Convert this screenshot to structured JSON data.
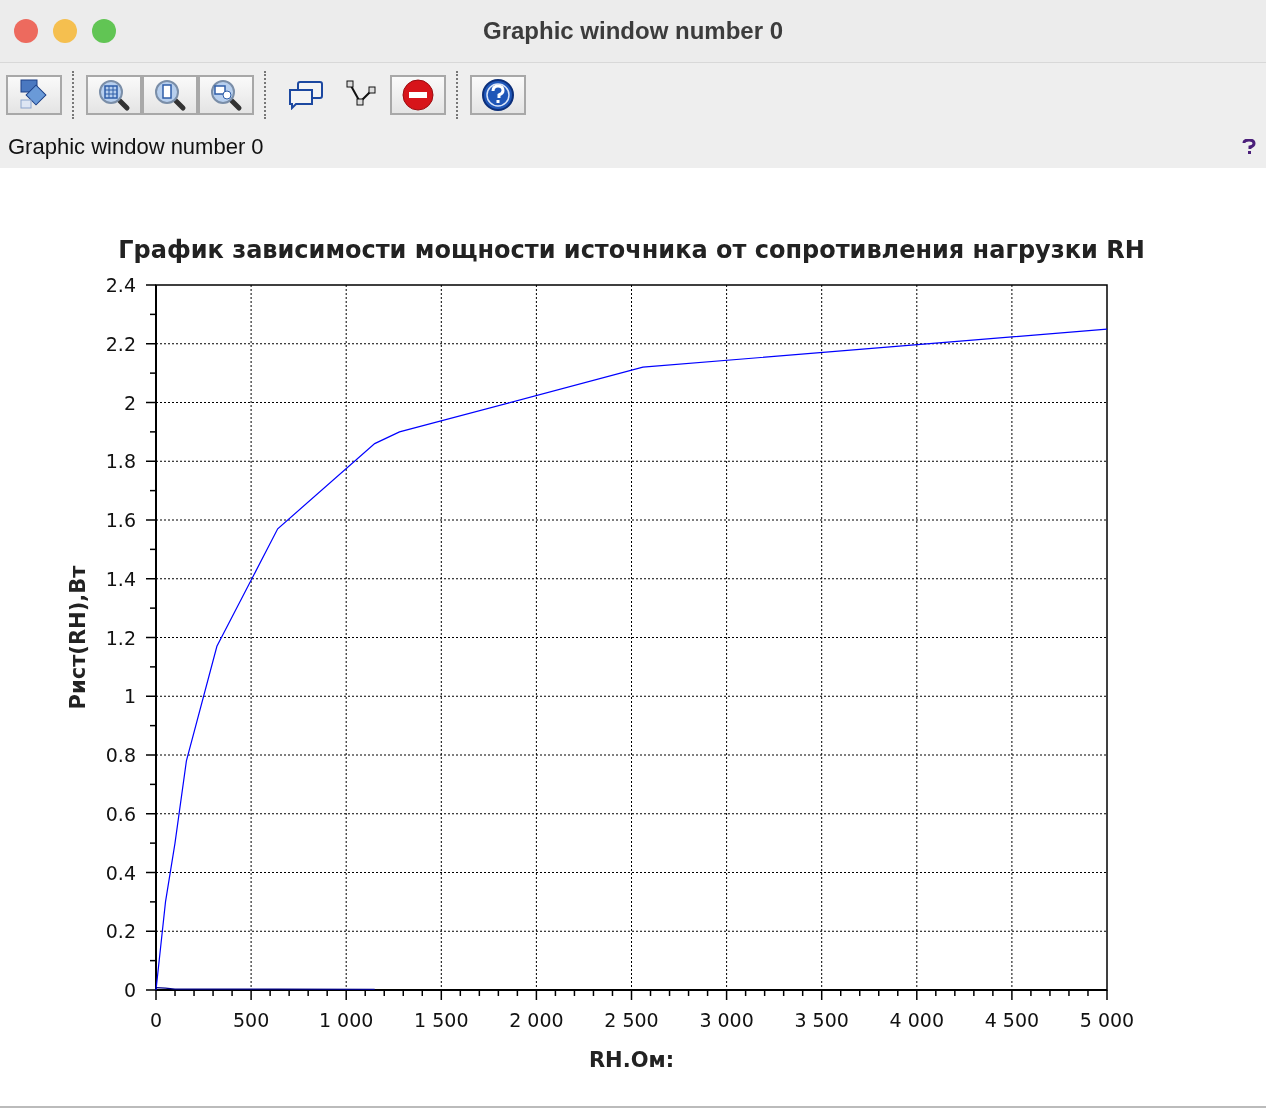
{
  "window": {
    "title": "Graphic window number 0"
  },
  "info_bar": {
    "label": "Graphic window number 0"
  },
  "figure": {
    "chart_data": {
      "type": "line",
      "title": "График зависимости мощности источника от сопротивления нагрузки RH",
      "xlabel": "RH.Ом:",
      "ylabel": "Рист(RH),Вт",
      "x": [
        0,
        50,
        100,
        160,
        320,
        640,
        1150,
        1280,
        2560,
        5000
      ],
      "series": [
        {
          "color": "#0000ff",
          "values": [
            0,
            0.3,
            0.5,
            0.78,
            1.17,
            1.57,
            1.86,
            1.9,
            2.12,
            2.25
          ]
        },
        {
          "color": "#00008b",
          "values": [
            0.008,
            0.006,
            0.003,
            0.003,
            0.003,
            0.003,
            0.002,
            null,
            null,
            null
          ]
        }
      ],
      "grid": true,
      "xlim": [
        0,
        5000
      ],
      "ylim": [
        0,
        2.4
      ],
      "xticks": [
        {
          "value": 0,
          "label": "0"
        },
        {
          "value": 500,
          "label": "500"
        },
        {
          "value": 1000,
          "label": "1 000"
        },
        {
          "value": 1500,
          "label": "1 500"
        },
        {
          "value": 2000,
          "label": "2 000"
        },
        {
          "value": 2500,
          "label": "2 500"
        },
        {
          "value": 3000,
          "label": "3 000"
        },
        {
          "value": 3500,
          "label": "3 500"
        },
        {
          "value": 4000,
          "label": "4 000"
        },
        {
          "value": 4500,
          "label": "4 500"
        },
        {
          "value": 5000,
          "label": "5 000"
        }
      ],
      "yticks": [
        {
          "value": 0,
          "label": "0"
        },
        {
          "value": 0.2,
          "label": "0.2"
        },
        {
          "value": 0.4,
          "label": "0.4"
        },
        {
          "value": 0.6,
          "label": "0.6"
        },
        {
          "value": 0.8,
          "label": "0.8"
        },
        {
          "value": 1,
          "label": "1"
        },
        {
          "value": 1.2,
          "label": "1.2"
        },
        {
          "value": 1.4,
          "label": "1.4"
        },
        {
          "value": 1.6,
          "label": "1.6"
        },
        {
          "value": 1.8,
          "label": "1.8"
        },
        {
          "value": 2,
          "label": "2"
        },
        {
          "value": 2.2,
          "label": "2.2"
        },
        {
          "value": 2.4,
          "label": "2.4"
        }
      ]
    }
  }
}
